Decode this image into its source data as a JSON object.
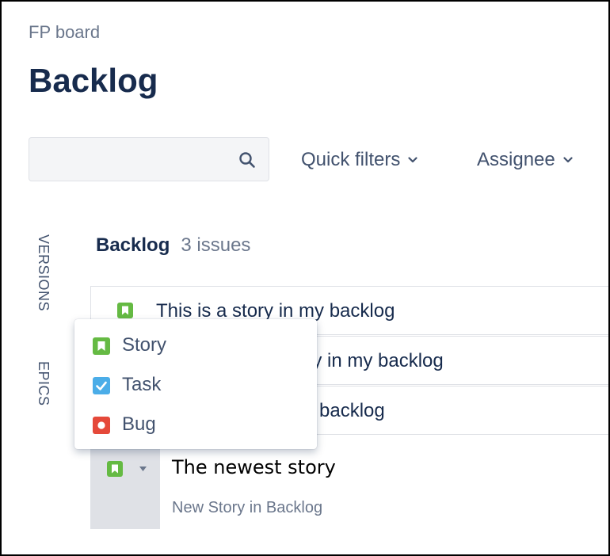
{
  "board": {
    "breadcrumb": "FP board",
    "title": "Backlog"
  },
  "toolbar": {
    "search_value": "",
    "quick_filters_label": "Quick filters",
    "assignee_label": "Assignee"
  },
  "side_tabs": {
    "versions": "VERSIONS",
    "epics": "EPICS"
  },
  "backlog": {
    "name": "Backlog",
    "count": "3 issues",
    "issues": [
      {
        "type": "story",
        "summary": "This is a story in my backlog"
      },
      {
        "type": "story",
        "summary": "ory in my backlog"
      },
      {
        "type": "story",
        "summary": "backlog"
      }
    ]
  },
  "new_issue": {
    "type": "story",
    "title": "The newest story",
    "hint": "New Story in Backlog"
  },
  "type_menu": {
    "items": [
      {
        "type": "story",
        "label": "Story"
      },
      {
        "type": "task",
        "label": "Task"
      },
      {
        "type": "bug",
        "label": "Bug"
      }
    ]
  },
  "colors": {
    "story": "#65ba43",
    "task": "#4bade8",
    "bug": "#e5493a"
  }
}
